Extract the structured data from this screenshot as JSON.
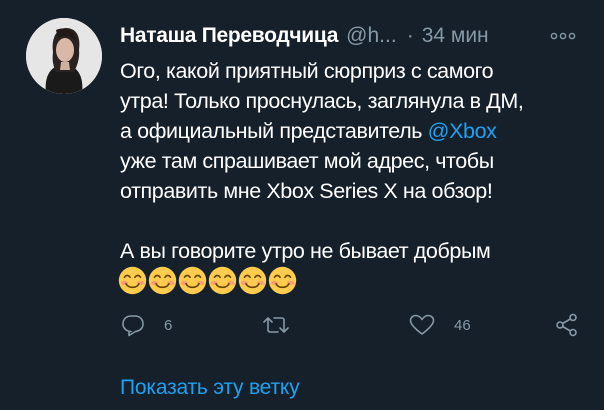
{
  "tweet": {
    "author_name": "Наташа Переводчица",
    "author_handle": "@h...",
    "separator": "·",
    "time": "34 мин",
    "lines": [
      "Ого, какой приятный сюрприз с самого",
      "утра! Только проснулась, заглянула в ДМ,",
      "а официальный представитель ",
      "уже там спрашивает мой адрес, чтобы",
      "отправить мне Xbox Series X на обзор!",
      "А вы говорите утро не бывает добрым"
    ],
    "mention": "@Xbox",
    "emoji_count": 6,
    "emoji_icon": "smiling-face-with-smiling-eyes-icon",
    "reply_count": "6",
    "retweet_count": "",
    "like_count": "46",
    "show_thread": "Показать эту ветку"
  },
  "colors": {
    "background": "#15202b",
    "text": "#ffffff",
    "secondary": "#8899a6",
    "accent": "#1da1f2"
  }
}
